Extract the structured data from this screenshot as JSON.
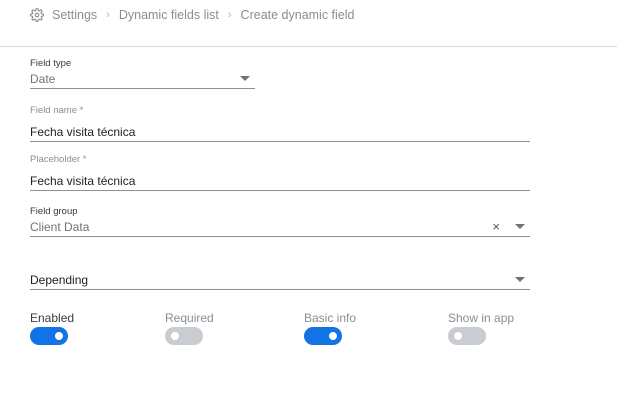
{
  "breadcrumb": {
    "icon": "gear-icon",
    "items": [
      "Settings",
      "Dynamic fields list",
      "Create dynamic field"
    ],
    "separator": "›"
  },
  "form": {
    "field_type": {
      "label": "Field type",
      "value": "Date"
    },
    "field_name": {
      "label": "Field name *",
      "value": "Fecha visita técnica"
    },
    "placeholder": {
      "label": "Placeholder *",
      "value": "Fecha visita técnica"
    },
    "field_group": {
      "label": "Field group",
      "value": "Client Data",
      "clear": "×"
    },
    "depending": {
      "value": "Depending"
    }
  },
  "toggles": [
    {
      "label": "Enabled",
      "on": true
    },
    {
      "label": "Required",
      "on": false
    },
    {
      "label": "Basic info",
      "on": true
    },
    {
      "label": "Show in app",
      "on": false
    }
  ],
  "colors": {
    "accent": "#1173e6",
    "toggle_off": "#c9ccd1"
  }
}
